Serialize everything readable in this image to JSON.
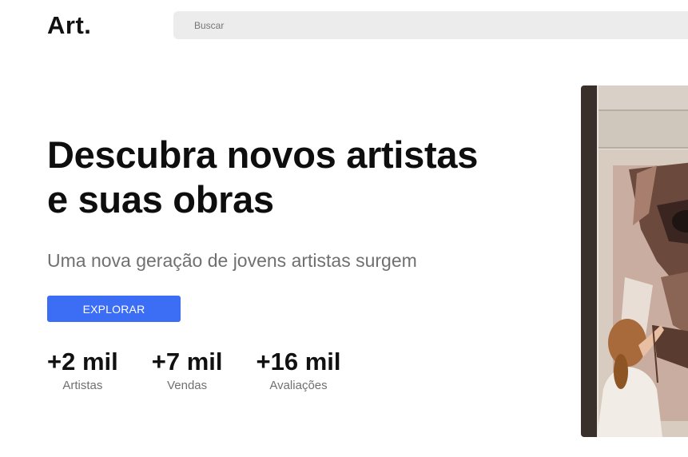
{
  "header": {
    "logo": "Art.",
    "search_placeholder": "Buscar"
  },
  "hero": {
    "title_line1": "Descubra novos artistas",
    "title_line2": "e suas obras",
    "subtitle": "Uma nova geração de jovens artistas surgem",
    "cta_label": "EXPLORAR",
    "image": {
      "description_icon": "artist-painting-image"
    }
  },
  "stats": [
    {
      "value": "+2 mil",
      "label": "Artistas"
    },
    {
      "value": "+7 mil",
      "label": "Vendas"
    },
    {
      "value": "+16 mil",
      "label": "Avaliações"
    }
  ],
  "colors": {
    "accent": "#3b6ef5",
    "search_bg": "#ececec",
    "muted_text": "#707070"
  }
}
